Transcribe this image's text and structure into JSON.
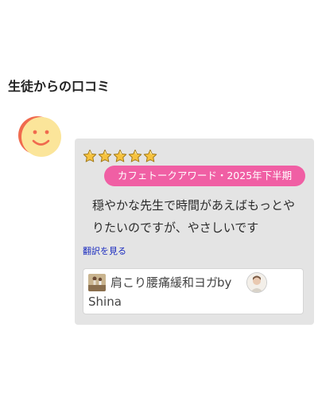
{
  "section": {
    "title": "生徒からの口コミ"
  },
  "reviewer": {
    "avatar_icon": "smiley-face-icon",
    "colors": {
      "face": "#fbe59a",
      "shadow": "#f06a4e",
      "features": "#f06a4e"
    }
  },
  "review": {
    "rating": 5,
    "max_rating": 5,
    "star_icon": "star-icon",
    "star_color": "#f6c23e",
    "award_badge": "カフェトークアワード・2025年下半期",
    "award_color": "#f05fa4",
    "text": "穏やかな先生で時間があえばもっとやりたいのですが、やさしいです",
    "translate_link": "翻訳を見る",
    "course": {
      "title": "肩こり腰痛緩和ヨガ",
      "by_label": "by",
      "teacher_name": "Shina",
      "thumbnail_icon": "yoga-class-thumbnail",
      "teacher_avatar_icon": "teacher-avatar"
    }
  }
}
